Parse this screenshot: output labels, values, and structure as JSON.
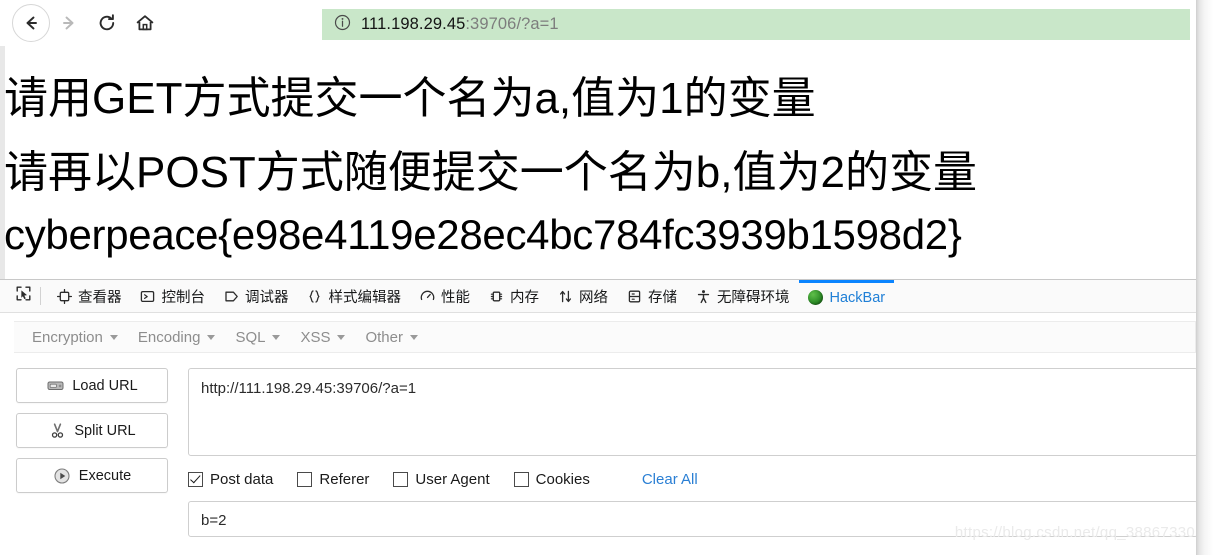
{
  "browser": {
    "nav": {
      "back": "back-arrow",
      "forward": "forward-arrow",
      "reload": "reload",
      "home": "home"
    },
    "address_bar": {
      "icon": "info-circle-icon",
      "host": "111.198.29.45",
      "rest": ":39706/?a=1",
      "full_url": "111.198.29.45:39706/?a=1",
      "background_color": "#c9e7c9"
    }
  },
  "page": {
    "line1": "请用GET方式提交一个名为a,值为1的变量",
    "line2": "请再以POST方式随便提交一个名为b,值为2的变量",
    "line3": "cyberpeace{e98e4119e28ec4bc784fc3939b1598d2}"
  },
  "devtools": {
    "picker_icon": "element-picker-icon",
    "tabs": [
      {
        "label": "查看器",
        "icon": "inspector-icon",
        "active": false
      },
      {
        "label": "控制台",
        "icon": "console-icon",
        "active": false
      },
      {
        "label": "调试器",
        "icon": "debugger-icon",
        "active": false
      },
      {
        "label": "样式编辑器",
        "icon": "style-editor-icon",
        "active": false
      },
      {
        "label": "性能",
        "icon": "performance-icon",
        "active": false
      },
      {
        "label": "内存",
        "icon": "memory-icon",
        "active": false
      },
      {
        "label": "网络",
        "icon": "network-icon",
        "active": false
      },
      {
        "label": "存储",
        "icon": "storage-icon",
        "active": false
      },
      {
        "label": "无障碍环境",
        "icon": "accessibility-icon",
        "active": false
      },
      {
        "label": "HackBar",
        "icon": "hackbar-icon",
        "active": true
      }
    ],
    "active_tab_accent": "#0a84ff"
  },
  "hackbar": {
    "menu": [
      {
        "label": "Encryption"
      },
      {
        "label": "Encoding"
      },
      {
        "label": "SQL"
      },
      {
        "label": "XSS"
      },
      {
        "label": "Other"
      }
    ],
    "buttons": [
      {
        "label": "Load URL",
        "icon": "disk-drive-icon"
      },
      {
        "label": "Split URL",
        "icon": "scissors-icon"
      },
      {
        "label": "Execute",
        "icon": "play-icon"
      }
    ],
    "url_field": {
      "value": "http://111.198.29.45:39706/?a=1",
      "placeholder": "http://"
    },
    "checkboxes": [
      {
        "label": "Post data",
        "checked": true
      },
      {
        "label": "Referer",
        "checked": false
      },
      {
        "label": "User Agent",
        "checked": false
      },
      {
        "label": "Cookies",
        "checked": false
      }
    ],
    "clear_all_label": "Clear All",
    "post_data_field": {
      "value": "b=2",
      "placeholder": ""
    }
  },
  "watermark": "https://blog.csdn.net/qq_38867330"
}
